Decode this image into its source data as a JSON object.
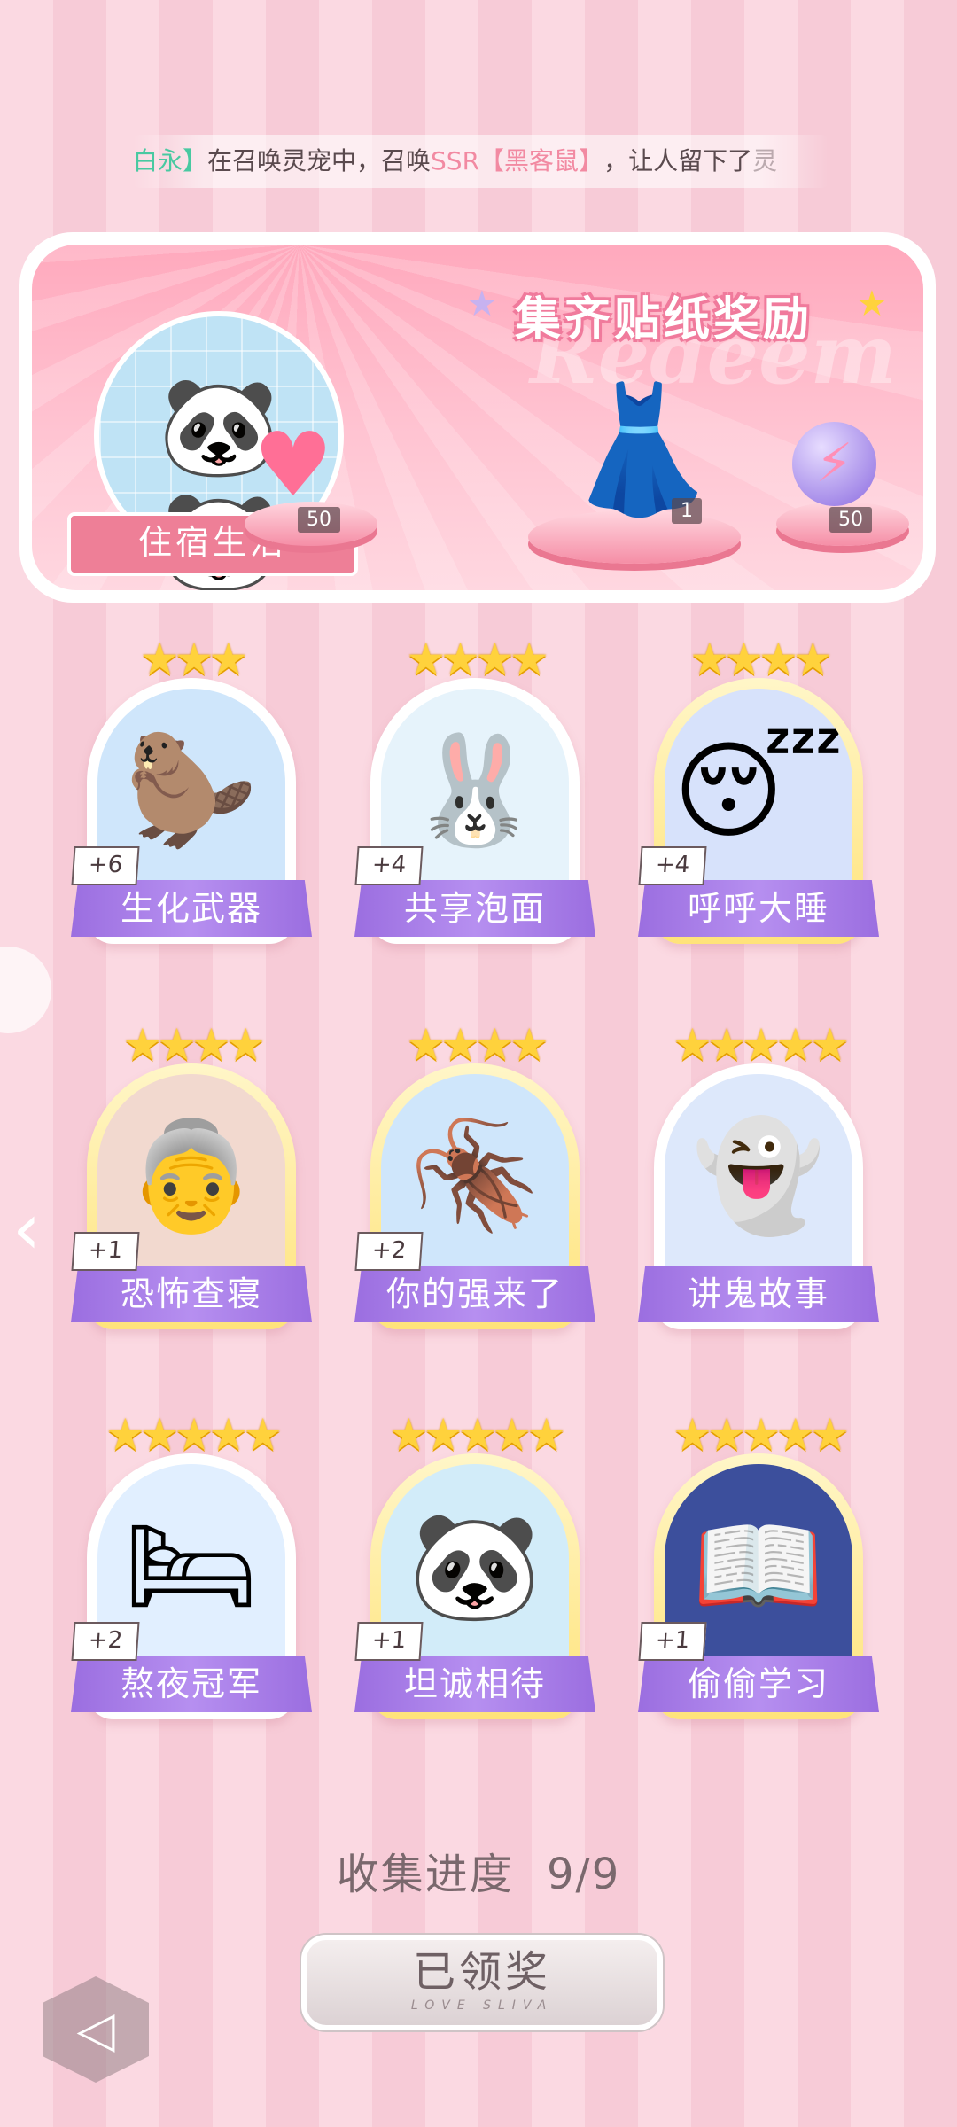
{
  "ticker": {
    "name": "白永】",
    "text1": "在召唤灵宠中，召唤",
    "rarity": "SSR",
    "pet": "【黑客鼠】",
    "text2": "，让人留下了",
    "tail": "灵"
  },
  "banner": {
    "title": "集齐贴纸奖励",
    "watermark": "Redeem",
    "category": "住宿生活",
    "rewards": [
      {
        "name": "heart-gem",
        "qty": "50"
      },
      {
        "name": "dress-outfit",
        "qty": "1"
      },
      {
        "name": "lightning-orb",
        "qty": "50"
      }
    ]
  },
  "stickers": [
    {
      "label": "生化武器",
      "count": "+6",
      "stars": "★★★",
      "emoji": "🦫"
    },
    {
      "label": "共享泡面",
      "count": "+4",
      "stars": "★★★★",
      "emoji": "🐰"
    },
    {
      "label": "呼呼大睡",
      "count": "+4",
      "stars": "★★★★",
      "emoji": "😴"
    },
    {
      "label": "恐怖查寝",
      "count": "+1",
      "stars": "★★★★",
      "emoji": "👵"
    },
    {
      "label": "你的强来了",
      "count": "+2",
      "stars": "★★★★",
      "emoji": "🪳"
    },
    {
      "label": "讲鬼故事",
      "count": "",
      "stars": "★★★★★",
      "emoji": "👻"
    },
    {
      "label": "熬夜冠军",
      "count": "+2",
      "stars": "★★★★★",
      "emoji": "🛏"
    },
    {
      "label": "坦诚相待",
      "count": "+1",
      "stars": "★★★★★",
      "emoji": "🐼"
    },
    {
      "label": "偷偷学习",
      "count": "+1",
      "stars": "★★★★★",
      "emoji": "📖"
    }
  ],
  "progress": {
    "label": "收集进度",
    "value": "9/9"
  },
  "claim_button": {
    "label": "已领奖",
    "sub": "LOVE SLIVA"
  },
  "colors": {
    "accent_purple": "#9b6ee0",
    "banner_pink": "#ffa9bd",
    "star_gold": "#ffd23c"
  }
}
